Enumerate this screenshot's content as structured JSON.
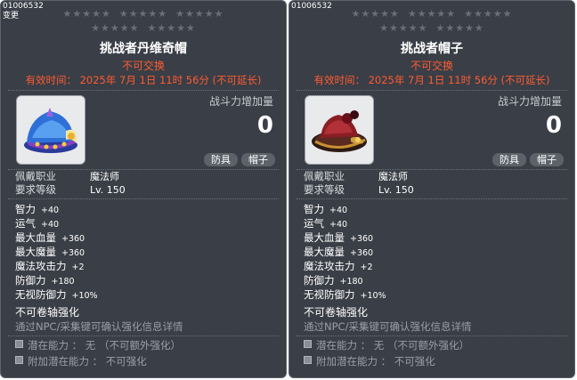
{
  "panels": [
    {
      "item_id": "01006532",
      "change_note": "变更",
      "stars_row1": "★★★★★  ★★★★★  ★★★★★",
      "stars_row2": "★★★★★  ★★★★★",
      "name": "挑战者丹维奇帽",
      "untradable": "不可交换",
      "expiry": "有效时间：  2025年  7月  1日  11时  56分  (不可延长)",
      "power_label": "战斗力增加量",
      "power_value": "0",
      "tags": [
        "防具",
        "帽子"
      ],
      "job_label": "佩戴职业",
      "job_value": "魔法师",
      "level_label": "要求等级",
      "level_value": "Lv. 150",
      "stats": [
        {
          "name": "智力",
          "value": "+40"
        },
        {
          "name": "运气",
          "value": "+40"
        },
        {
          "name": "最大血量",
          "value": "+360"
        },
        {
          "name": "最大魔量",
          "value": "+360"
        },
        {
          "name": "魔法攻击力",
          "value": "+2"
        },
        {
          "name": "防御力",
          "value": "+180"
        },
        {
          "name": "无视防御力",
          "value": "+10%"
        }
      ],
      "no_scroll": "不可卷轴强化",
      "npc_note": "通过NPC/采集键可确认强化信息详情",
      "potential": "潜在能力 ： 无 （不可额外强化）",
      "bonus_potential": "附加潜在能力 ： 不可强化",
      "icon": "blue-hat-icon"
    },
    {
      "item_id": "01006532",
      "stars_row1": "★★★★★  ★★★★★  ★★★★★",
      "stars_row2": "★★★★★  ★★★★★",
      "name": "挑战者帽子",
      "untradable": "不可交换",
      "expiry": "有效时间：  2025年  7月  1日  11时  56分  (不可延长)",
      "power_label": "战斗力增加量",
      "power_value": "0",
      "tags": [
        "防具",
        "帽子"
      ],
      "job_label": "佩戴职业",
      "job_value": "魔法师",
      "level_label": "要求等级",
      "level_value": "Lv. 150",
      "stats": [
        {
          "name": "智力",
          "value": "+40"
        },
        {
          "name": "运气",
          "value": "+40"
        },
        {
          "name": "最大血量",
          "value": "+360"
        },
        {
          "name": "最大魔量",
          "value": "+360"
        },
        {
          "name": "魔法攻击力",
          "value": "+2"
        },
        {
          "name": "防御力",
          "value": "+180"
        },
        {
          "name": "无视防御力",
          "value": "+10%"
        }
      ],
      "no_scroll": "不可卷轴强化",
      "npc_note": "通过NPC/采集键可确认强化信息详情",
      "potential": "潜在能力 ： 无 （不可额外强化）",
      "bonus_potential": "附加潜在能力 ： 不可强化",
      "icon": "red-hat-icon"
    }
  ],
  "colors": {
    "panel_bg": "#3a3e46",
    "warning": "#ff5b33",
    "muted": "#9a9ea6"
  }
}
